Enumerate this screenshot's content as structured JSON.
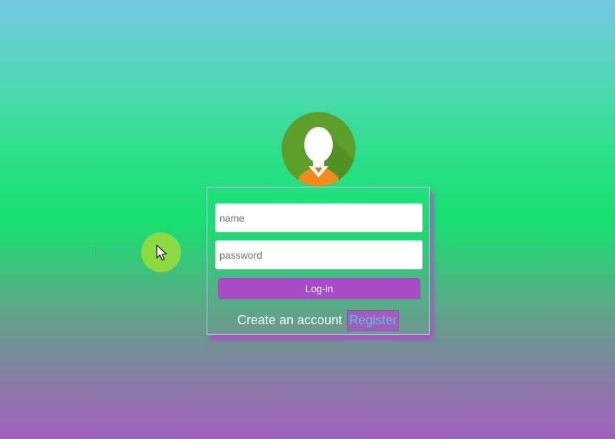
{
  "login_form": {
    "name_placeholder": "name",
    "password_placeholder": "password",
    "login_label": "Log-in",
    "create_account_text": "Create an account",
    "register_label": "Register"
  },
  "icons": {
    "avatar": "user-avatar-icon",
    "cursor": "mouse-pointer-icon"
  },
  "colors": {
    "button": "#a74cc5",
    "register_bg": "#a55bc1",
    "register_text": "#4fc6d6",
    "avatar_bg": "#5a9e2e",
    "cursor_highlight": "#96dc3c"
  }
}
